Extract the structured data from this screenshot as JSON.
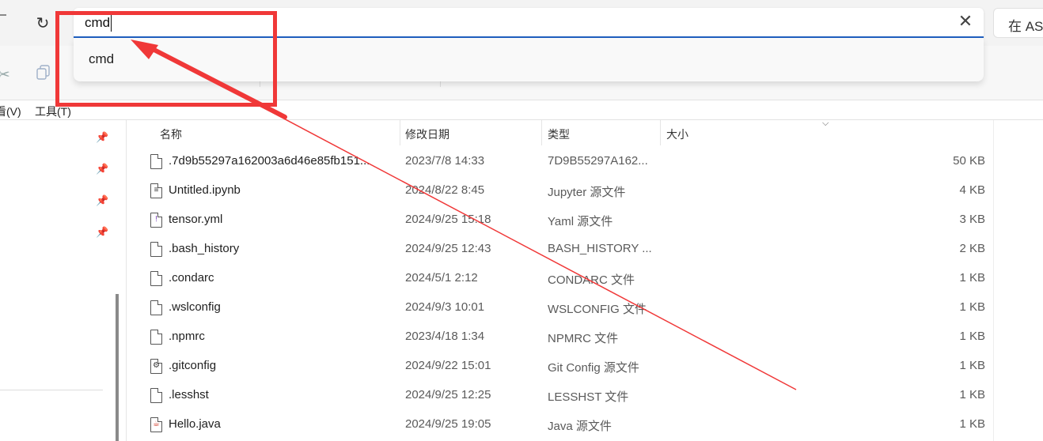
{
  "address_bar": {
    "value": "cmd",
    "clear_icon": "close-icon"
  },
  "search": {
    "label": "在 AS"
  },
  "suggestion": {
    "items": [
      "cmd"
    ]
  },
  "menu": {
    "view": "看(V)",
    "tools": "工具(T)"
  },
  "columns": {
    "name": "名称",
    "modified": "修改日期",
    "type": "类型",
    "size": "大小"
  },
  "files": [
    {
      "name": ".7d9b55297a162003a6d46e85fb151...",
      "date": "2023/7/8 14:33",
      "type": "7D9B55297A162...",
      "size": "50 KB",
      "icon": "file-icon"
    },
    {
      "name": "Untitled.ipynb",
      "date": "2024/8/22 8:45",
      "type": "Jupyter 源文件",
      "size": "4 KB",
      "icon": "notebook-file-icon"
    },
    {
      "name": "tensor.yml",
      "date": "2024/9/25 15:18",
      "type": "Yaml 源文件",
      "size": "3 KB",
      "icon": "yaml-file-icon"
    },
    {
      "name": ".bash_history",
      "date": "2024/9/25 12:43",
      "type": "BASH_HISTORY ...",
      "size": "2 KB",
      "icon": "file-icon"
    },
    {
      "name": ".condarc",
      "date": "2024/5/1 2:12",
      "type": "CONDARC 文件",
      "size": "1 KB",
      "icon": "file-icon"
    },
    {
      "name": ".wslconfig",
      "date": "2024/9/3 10:01",
      "type": "WSLCONFIG 文件",
      "size": "1 KB",
      "icon": "file-icon"
    },
    {
      "name": ".npmrc",
      "date": "2023/4/18 1:34",
      "type": "NPMRC 文件",
      "size": "1 KB",
      "icon": "file-icon"
    },
    {
      "name": ".gitconfig",
      "date": "2024/9/22 15:01",
      "type": "Git Config 源文件",
      "size": "1 KB",
      "icon": "config-file-icon"
    },
    {
      "name": ".lesshst",
      "date": "2024/9/25 12:25",
      "type": "LESSHST 文件",
      "size": "1 KB",
      "icon": "file-icon"
    },
    {
      "name": "Hello.java",
      "date": "2024/9/25 19:05",
      "type": "Java 源文件",
      "size": "1 KB",
      "icon": "java-file-icon"
    }
  ],
  "colors": {
    "annotation": "#f03838",
    "focus": "#1f5fbf"
  }
}
